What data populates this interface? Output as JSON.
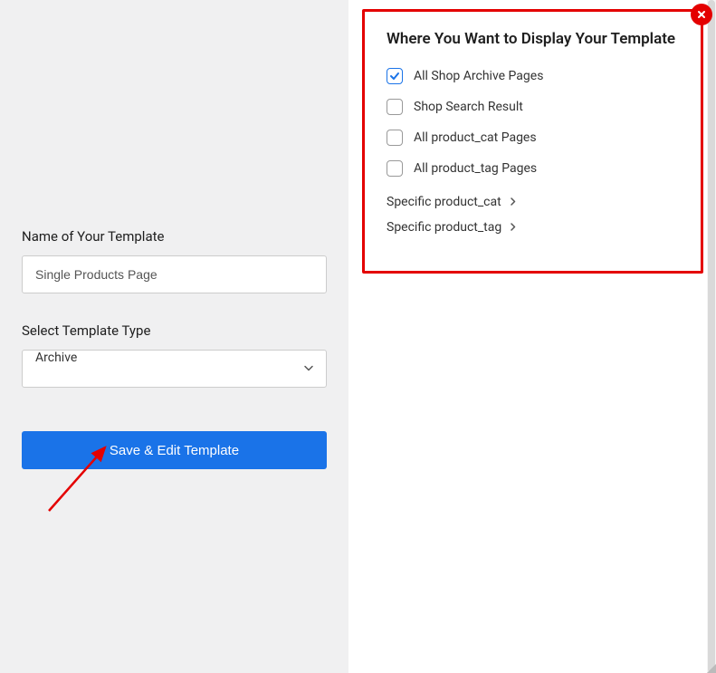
{
  "left": {
    "name_label": "Name of Your Template",
    "name_value": "Single Products Page",
    "type_label": "Select Template Type",
    "type_value": "Archive",
    "save_btn": "Save & Edit Template"
  },
  "right": {
    "title": "Where You Want to Display Your Template",
    "checkboxes": [
      {
        "label": "All Shop Archive Pages",
        "checked": true
      },
      {
        "label": "Shop Search Result",
        "checked": false
      },
      {
        "label": "All product_cat Pages",
        "checked": false
      },
      {
        "label": "All product_tag Pages",
        "checked": false
      }
    ],
    "expanders": [
      {
        "label": "Specific product_cat"
      },
      {
        "label": "Specific product_tag"
      }
    ]
  },
  "annotations": {
    "arrow_color": "#e40000",
    "highlight_color": "#e40000"
  }
}
